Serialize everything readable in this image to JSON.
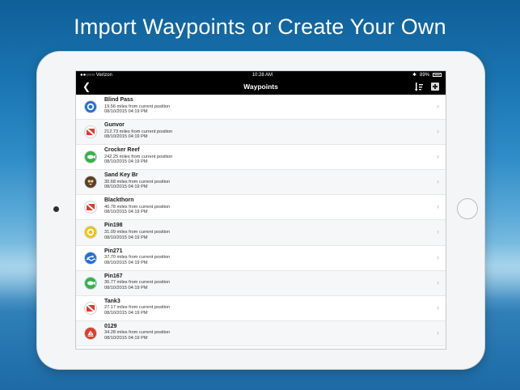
{
  "headline": "Import Waypoints or Create Your Own",
  "status_bar": {
    "carrier": "●●○○○ Verizon",
    "time": "10:28 AM",
    "battery": "89%"
  },
  "nav": {
    "title": "Waypoints",
    "back_icon": "chevron-left-icon",
    "sort_icon": "sort-icon",
    "add_icon": "add-icon"
  },
  "waypoints": [
    {
      "name": "Blind Pass",
      "distance": "19.56 miles from current position",
      "date": "08/10/2015 04:19 PM",
      "icon": "blue-ring-icon",
      "color": "#1f6fd8"
    },
    {
      "name": "Gunvor",
      "distance": "212.73 miles from current position",
      "date": "08/10/2015 04:19 PM",
      "icon": "dive-flag-icon",
      "color": "#e03a2e"
    },
    {
      "name": "Crocker Reef",
      "distance": "242.25 miles from current position",
      "date": "08/10/2015 04:19 PM",
      "icon": "fish-icon",
      "color": "#35b34a"
    },
    {
      "name": "Sand Key Br",
      "distance": "30.68 miles from current position",
      "date": "08/10/2015 04:19 PM",
      "icon": "owl-icon",
      "color": "#6b4a2c"
    },
    {
      "name": "Blackthorn",
      "distance": "40.78 miles from current position",
      "date": "08/10/2015 04:19 PM",
      "icon": "dive-flag-icon",
      "color": "#e03a2e"
    },
    {
      "name": "Pin198",
      "distance": "31.09 miles from current position",
      "date": "08/10/2015 04:19 PM",
      "icon": "yellow-ring-icon",
      "color": "#f2c40f"
    },
    {
      "name": "Pin271",
      "distance": "37.70 miles from current position",
      "date": "08/10/2015 04:19 PM",
      "icon": "swimmer-icon",
      "color": "#1f6fd8"
    },
    {
      "name": "Pin167",
      "distance": "36.77 miles from current position",
      "date": "08/10/2015 04:19 PM",
      "icon": "fish-icon",
      "color": "#35b34a"
    },
    {
      "name": "Tank3",
      "distance": "27.17 miles from current position",
      "date": "08/10/2015 04:19 PM",
      "icon": "dive-flag-icon",
      "color": "#e03a2e"
    },
    {
      "name": "0129",
      "distance": "34.28 miles from current position",
      "date": "08/10/2015 04:19 PM",
      "icon": "sailboat-icon",
      "color": "#e03a2e"
    }
  ]
}
